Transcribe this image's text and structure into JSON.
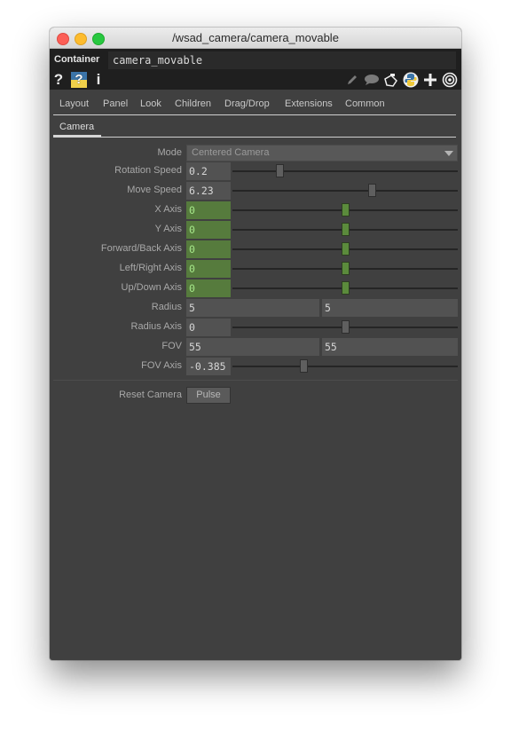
{
  "window": {
    "title": "/wsad_camera/camera_movable",
    "traffic_lights": {
      "close": "#fc5f57",
      "minimize": "#fdbc2e",
      "maximize": "#28c840"
    }
  },
  "header": {
    "operator_type": "Container",
    "operator_name": "camera_movable",
    "left_icons": [
      {
        "name": "help-icon",
        "glyph": "?"
      },
      {
        "name": "python-help-icon",
        "glyph": "?"
      },
      {
        "name": "info-icon",
        "glyph": "i"
      }
    ],
    "right_icons": [
      "pencil-icon",
      "comment-icon",
      "clipboard-icon",
      "python-icon",
      "plus-icon",
      "target-icon"
    ]
  },
  "tabs": [
    "Layout",
    "Panel",
    "Look",
    "Children",
    "Drag/Drop",
    "Extensions",
    "Common"
  ],
  "subtabs": {
    "active": "Camera"
  },
  "params": {
    "mode": {
      "label": "Mode",
      "value": "Centered Camera"
    },
    "rotation_speed": {
      "label": "Rotation Speed",
      "value": "0.2",
      "slider_fraction": 0.21
    },
    "move_speed": {
      "label": "Move Speed",
      "value": "6.23",
      "slider_fraction": 0.62
    },
    "x_axis": {
      "label": "X Axis",
      "value": "0",
      "slider_fraction": 0.5
    },
    "y_axis": {
      "label": "Y Axis",
      "value": "0",
      "slider_fraction": 0.5
    },
    "forward_back_axis": {
      "label": "Forward/Back Axis",
      "value": "0",
      "slider_fraction": 0.5
    },
    "left_right_axis": {
      "label": "Left/Right Axis",
      "value": "0",
      "slider_fraction": 0.5
    },
    "up_down_axis": {
      "label": "Up/Down Axis",
      "value": "0",
      "slider_fraction": 0.5
    },
    "radius": {
      "label": "Radius",
      "value1": "5",
      "value2": "5"
    },
    "radius_axis": {
      "label": "Radius Axis",
      "value": "0",
      "slider_fraction": 0.5
    },
    "fov": {
      "label": "FOV",
      "value1": "55",
      "value2": "55"
    },
    "fov_axis": {
      "label": "FOV Axis",
      "value": "-0.385",
      "slider_fraction": 0.315
    },
    "reset_camera": {
      "label": "Reset Camera",
      "button": "Pulse"
    }
  },
  "colors": {
    "panel_bg": "#404040",
    "active_green": "#567b3d",
    "green_text": "#a6e88a"
  }
}
